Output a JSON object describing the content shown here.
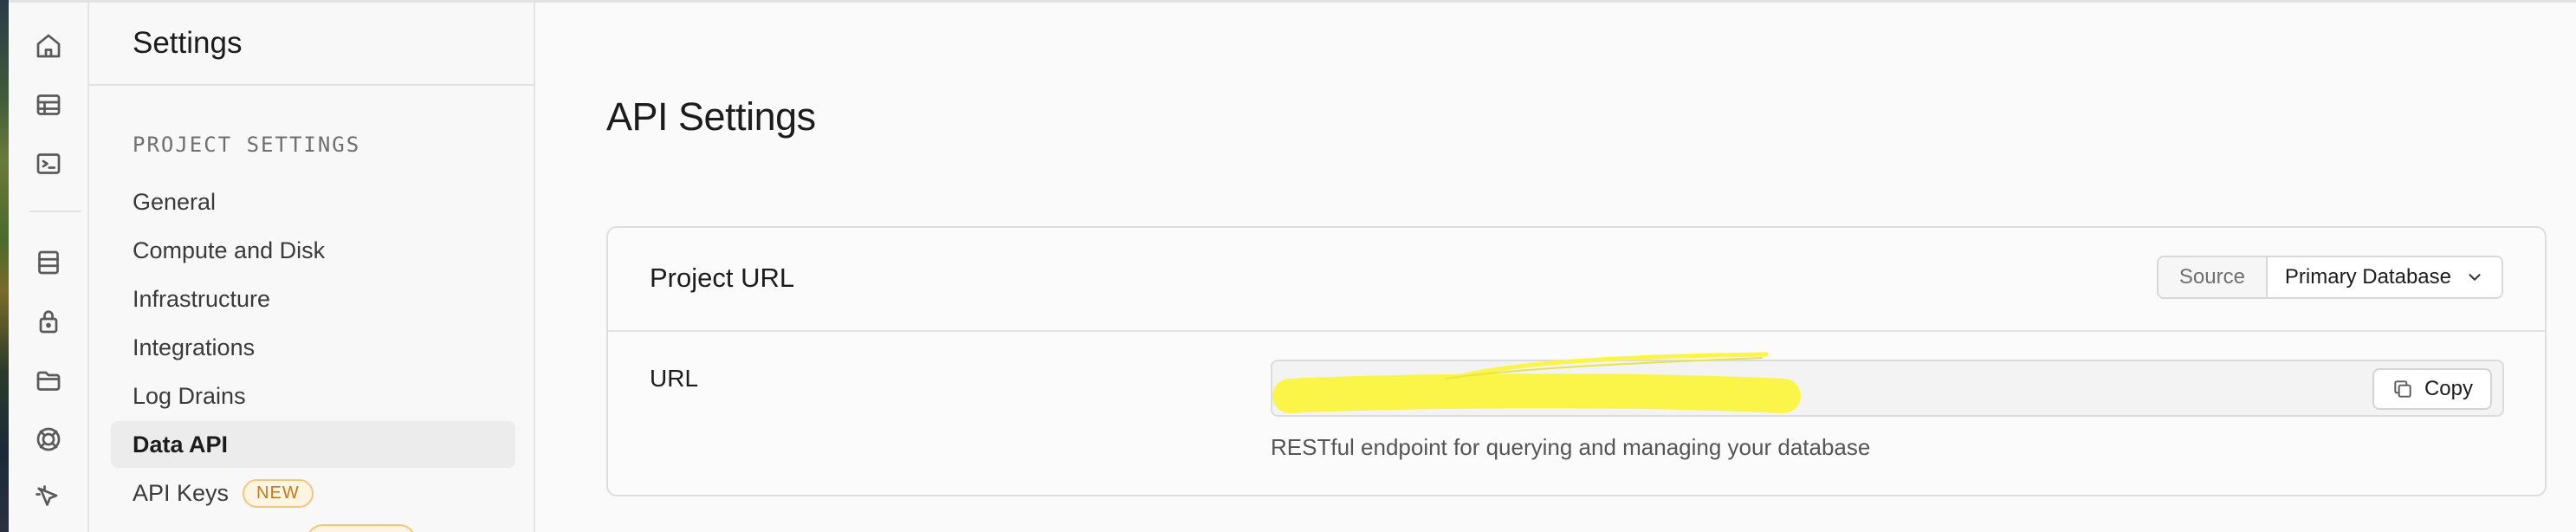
{
  "sidebar": {
    "title": "Settings",
    "section_label": "PROJECT SETTINGS",
    "items": [
      {
        "label": "General"
      },
      {
        "label": "Compute and Disk"
      },
      {
        "label": "Infrastructure"
      },
      {
        "label": "Integrations"
      },
      {
        "label": "Log Drains"
      },
      {
        "label": "Data API",
        "active": true
      },
      {
        "label": "API Keys",
        "badge": "NEW"
      }
    ]
  },
  "rail": {
    "icons": [
      "home-icon",
      "table-editor-icon",
      "sql-editor-icon",
      "database-icon",
      "auth-lock-icon",
      "storage-folder-icon",
      "realtime-icon",
      "cursor-icon"
    ]
  },
  "main": {
    "page_title": "API Settings",
    "card": {
      "title": "Project URL",
      "source_label": "Source",
      "source_value": "Primary Database",
      "url_label": "URL",
      "url_value": "",
      "copy_label": "Copy",
      "helper_text": "RESTful endpoint for querying and managing your database"
    }
  },
  "colors": {
    "badge_text": "#c47a16",
    "badge_border": "#f2c77a",
    "redaction_highlight": "#fbf54a"
  }
}
